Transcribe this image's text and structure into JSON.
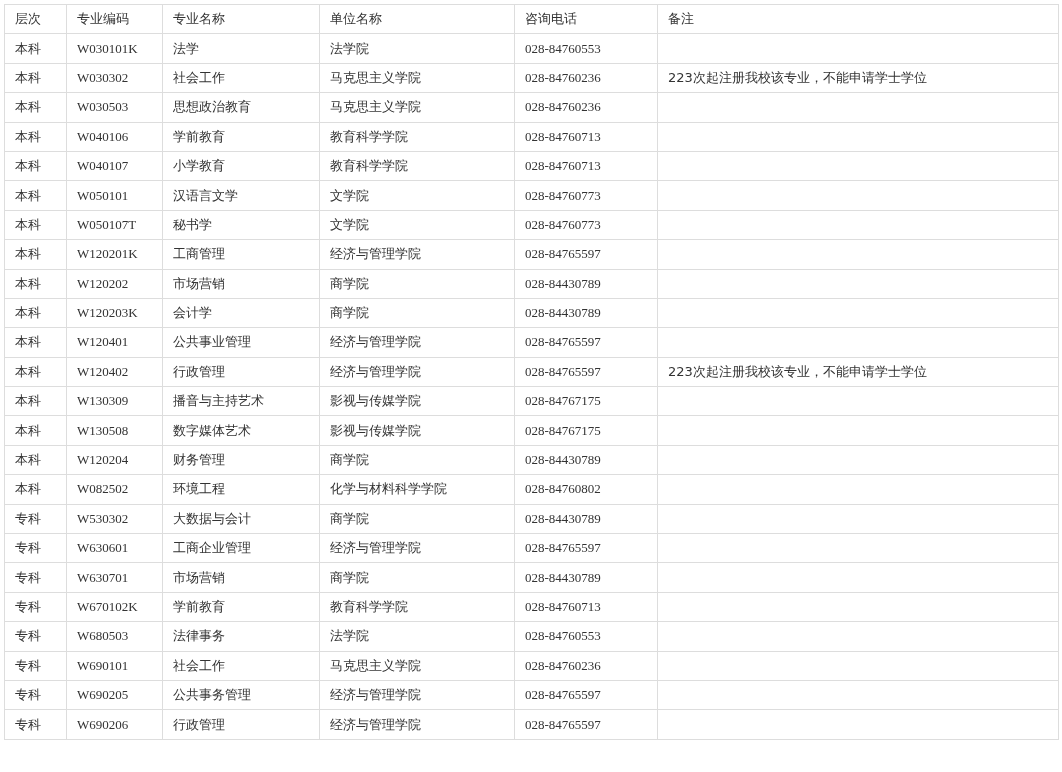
{
  "table": {
    "columns": [
      "层次",
      "专业编码",
      "专业名称",
      "单位名称",
      "咨询电话",
      "备注"
    ],
    "rows": [
      {
        "level": "本科",
        "code": "W030101K",
        "major": "法学",
        "unit": "法学院",
        "phone": "028-84760553"
      },
      {
        "level": "本科",
        "code": "W030302",
        "major": "社会工作",
        "unit": "马克思主义学院",
        "phone": "028-84760236",
        "note": "223次起注册我校该专业，不能申请学士学位"
      },
      {
        "level": "本科",
        "code": "W030503",
        "major": "思想政治教育",
        "unit": "马克思主义学院",
        "phone": "028-84760236"
      },
      {
        "level": "本科",
        "code": "W040106",
        "major": "学前教育",
        "unit": "教育科学学院",
        "phone": "028-84760713"
      },
      {
        "level": "本科",
        "code": "W040107",
        "major": "小学教育",
        "unit": "教育科学学院",
        "phone": "028-84760713"
      },
      {
        "level": "本科",
        "code": "W050101",
        "major": "汉语言文学",
        "unit": "文学院",
        "phone": "028-84760773"
      },
      {
        "level": "本科",
        "code": "W050107T",
        "major": "秘书学",
        "unit": "文学院",
        "phone": "028-84760773"
      },
      {
        "level": "本科",
        "code": "W120201K",
        "major": "工商管理",
        "unit": "经济与管理学院",
        "phone": "028-84765597"
      },
      {
        "level": "本科",
        "code": "W120202",
        "major": "市场营销",
        "unit": "商学院",
        "phone": "028-84430789"
      },
      {
        "level": "本科",
        "code": "W120203K",
        "major": "会计学",
        "unit": "商学院",
        "phone": "028-84430789"
      },
      {
        "level": "本科",
        "code": "W120401",
        "major": "公共事业管理",
        "unit": "经济与管理学院",
        "phone": "028-84765597"
      },
      {
        "level": "本科",
        "code": "W120402",
        "major": "行政管理",
        "unit": "经济与管理学院",
        "phone": "028-84765597",
        "note": "223次起注册我校该专业，不能申请学士学位"
      },
      {
        "level": "本科",
        "code": "W130309",
        "major": "播音与主持艺术",
        "unit": "影视与传媒学院",
        "phone": "028-84767175"
      },
      {
        "level": "本科",
        "code": "W130508",
        "major": "数字媒体艺术",
        "unit": "影视与传媒学院",
        "phone": "028-84767175"
      },
      {
        "level": "本科",
        "code": "W120204",
        "major": "财务管理",
        "unit": "商学院",
        "phone": "028-84430789"
      },
      {
        "level": "本科",
        "code": "W082502",
        "major": "环境工程",
        "unit": "化学与材料科学学院",
        "phone": "028-84760802"
      },
      {
        "level": "专科",
        "code": "W530302",
        "major": "大数据与会计",
        "unit": "商学院",
        "phone": "028-84430789"
      },
      {
        "level": "专科",
        "code": "W630601",
        "major": "工商企业管理",
        "unit": "经济与管理学院",
        "phone": "028-84765597"
      },
      {
        "level": "专科",
        "code": "W630701",
        "major": "市场营销",
        "unit": "商学院",
        "phone": "028-84430789"
      },
      {
        "level": "专科",
        "code": "W670102K",
        "major": "学前教育",
        "unit": "教育科学学院",
        "phone": "028-84760713"
      },
      {
        "level": "专科",
        "code": "W680503",
        "major": "法律事务",
        "unit": "法学院",
        "phone": "028-84760553"
      },
      {
        "level": "专科",
        "code": "W690101",
        "major": "社会工作",
        "unit": "马克思主义学院",
        "phone": "028-84760236"
      },
      {
        "level": "专科",
        "code": "W690205",
        "major": "公共事务管理",
        "unit": "经济与管理学院",
        "phone": "028-84765597"
      },
      {
        "level": "专科",
        "code": "W690206",
        "major": "行政管理",
        "unit": "经济与管理学院",
        "phone": "028-84765597"
      }
    ]
  }
}
